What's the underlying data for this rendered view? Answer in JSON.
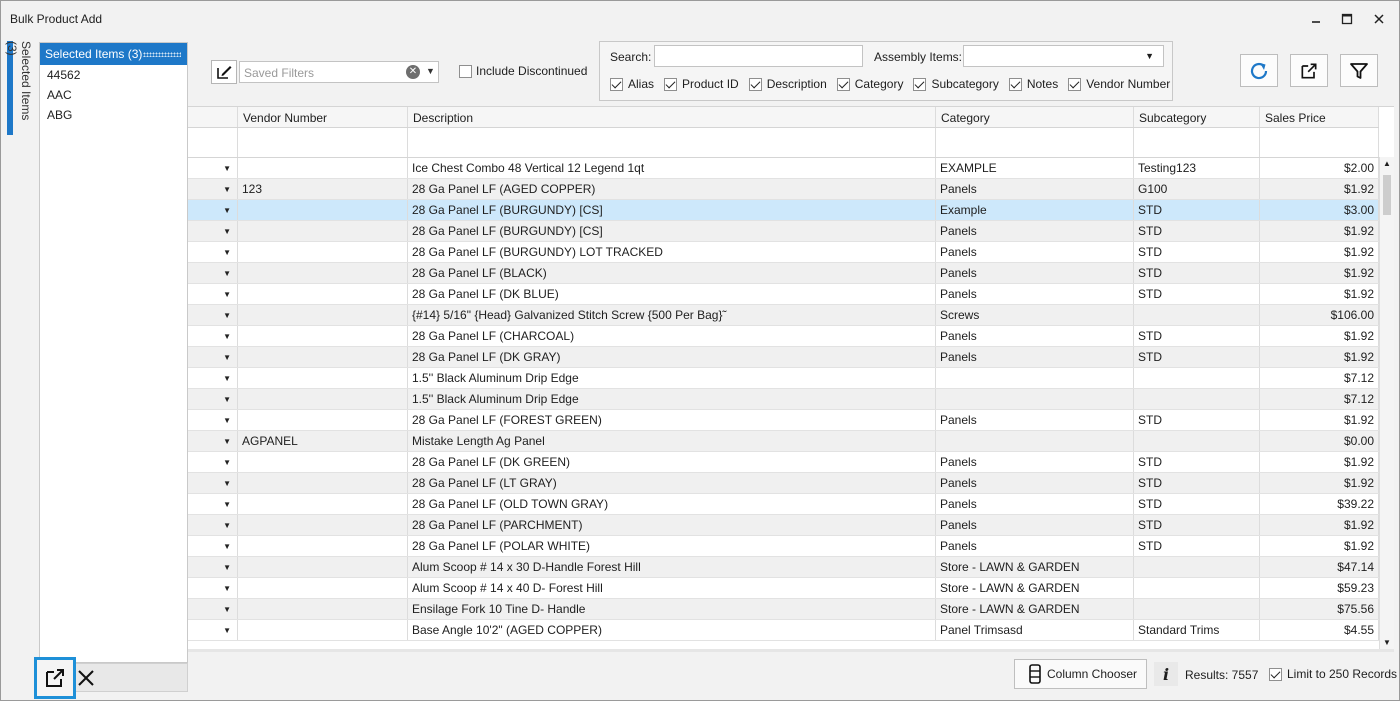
{
  "window": {
    "title": "Bulk Product Add"
  },
  "side_tab": {
    "label": "Selected Items (3)"
  },
  "selected_panel": {
    "header": "Selected Items (3)",
    "items": [
      "44562",
      "AAC",
      "ABG"
    ]
  },
  "toolbar": {
    "saved_filters_placeholder": "Saved Filters",
    "include_discontinued": {
      "label": "Include Discontinued",
      "checked": false
    }
  },
  "search": {
    "label": "Search:",
    "value": "",
    "assembly_label": "Assembly Items:",
    "assembly_value": "",
    "filters": [
      {
        "label": "Alias",
        "checked": true
      },
      {
        "label": "Product ID",
        "checked": true
      },
      {
        "label": "Description",
        "checked": true
      },
      {
        "label": "Category",
        "checked": true
      },
      {
        "label": "Subcategory",
        "checked": true
      },
      {
        "label": "Notes",
        "checked": true
      },
      {
        "label": "Vendor Number",
        "checked": true
      }
    ]
  },
  "grid": {
    "columns": [
      "",
      "Vendor Number",
      "Description",
      "Category",
      "Subcategory",
      "Sales Price"
    ],
    "rows": [
      {
        "vendor": "",
        "description": "Ice Chest Combo 48 Vertical 12 Legend 1qt",
        "category": "EXAMPLE",
        "subcategory": "Testing123",
        "price": "$2.00"
      },
      {
        "vendor": "123",
        "description": "28 Ga Panel LF (AGED COPPER)",
        "category": "Panels",
        "subcategory": "G100",
        "price": "$1.92"
      },
      {
        "vendor": "",
        "description": "28 Ga Panel LF (BURGUNDY) [CS]",
        "category": "Example",
        "subcategory": "STD",
        "price": "$3.00",
        "selected": true
      },
      {
        "vendor": "",
        "description": "28 Ga Panel LF (BURGUNDY) [CS]",
        "category": "Panels",
        "subcategory": "STD",
        "price": "$1.92"
      },
      {
        "vendor": "",
        "description": "28 Ga Panel LF (BURGUNDY) LOT TRACKED",
        "category": "Panels",
        "subcategory": "STD",
        "price": "$1.92"
      },
      {
        "vendor": "",
        "description": "28 Ga Panel LF (BLACK)",
        "category": "Panels",
        "subcategory": "STD",
        "price": "$1.92"
      },
      {
        "vendor": "",
        "description": "28 Ga Panel LF (DK BLUE)",
        "category": "Panels",
        "subcategory": "STD",
        "price": "$1.92"
      },
      {
        "vendor": "",
        "description": "{#14} 5/16\" {Head} Galvanized Stitch Screw {500 Per Bag}˜",
        "category": "Screws",
        "subcategory": "",
        "price": "$106.00"
      },
      {
        "vendor": "",
        "description": "28 Ga Panel LF (CHARCOAL)",
        "category": "Panels",
        "subcategory": "STD",
        "price": "$1.92"
      },
      {
        "vendor": "",
        "description": "28 Ga Panel LF (DK GRAY)",
        "category": "Panels",
        "subcategory": "STD",
        "price": "$1.92"
      },
      {
        "vendor": "",
        "description": "1.5'' Black  Aluminum Drip Edge",
        "category": "",
        "subcategory": "",
        "price": "$7.12"
      },
      {
        "vendor": "",
        "description": "1.5'' Black  Aluminum Drip Edge",
        "category": "",
        "subcategory": "",
        "price": "$7.12"
      },
      {
        "vendor": "",
        "description": "28 Ga Panel LF (FOREST GREEN)",
        "category": "Panels",
        "subcategory": "STD",
        "price": "$1.92"
      },
      {
        "vendor": "AGPANEL",
        "description": "Mistake Length Ag Panel",
        "category": "",
        "subcategory": "",
        "price": "$0.00"
      },
      {
        "vendor": "",
        "description": "28 Ga Panel LF (DK GREEN)",
        "category": "Panels",
        "subcategory": "STD",
        "price": "$1.92"
      },
      {
        "vendor": "",
        "description": "28 Ga Panel LF (LT GRAY)",
        "category": "Panels",
        "subcategory": "STD",
        "price": "$1.92"
      },
      {
        "vendor": "",
        "description": "28 Ga Panel LF (OLD TOWN GRAY)",
        "category": "Panels",
        "subcategory": "STD",
        "price": "$39.22"
      },
      {
        "vendor": "",
        "description": "28 Ga Panel LF (PARCHMENT)",
        "category": "Panels",
        "subcategory": "STD",
        "price": "$1.92"
      },
      {
        "vendor": "",
        "description": "28 Ga Panel LF (POLAR WHITE)",
        "category": "Panels",
        "subcategory": "STD",
        "price": "$1.92"
      },
      {
        "vendor": "",
        "description": "Alum Scoop # 14 x 30 D-Handle Forest Hill",
        "category": "Store - LAWN & GARDEN",
        "subcategory": "",
        "price": "$47.14"
      },
      {
        "vendor": "",
        "description": "Alum Scoop # 14 x 40 D- Forest Hill",
        "category": "Store - LAWN & GARDEN",
        "subcategory": "",
        "price": "$59.23"
      },
      {
        "vendor": "",
        "description": "Ensilage Fork 10 Tine D- Handle",
        "category": "Store - LAWN & GARDEN",
        "subcategory": "",
        "price": "$75.56"
      },
      {
        "vendor": "",
        "description": "Base Angle 10'2\" (AGED COPPER)",
        "category": "Panel Trimsasd",
        "subcategory": "Standard Trims",
        "price": "$4.55"
      }
    ]
  },
  "footer": {
    "column_chooser": "Column Chooser",
    "results": "Results: 7557",
    "limit_label": "Limit to 250 Records",
    "limit_checked": true
  }
}
